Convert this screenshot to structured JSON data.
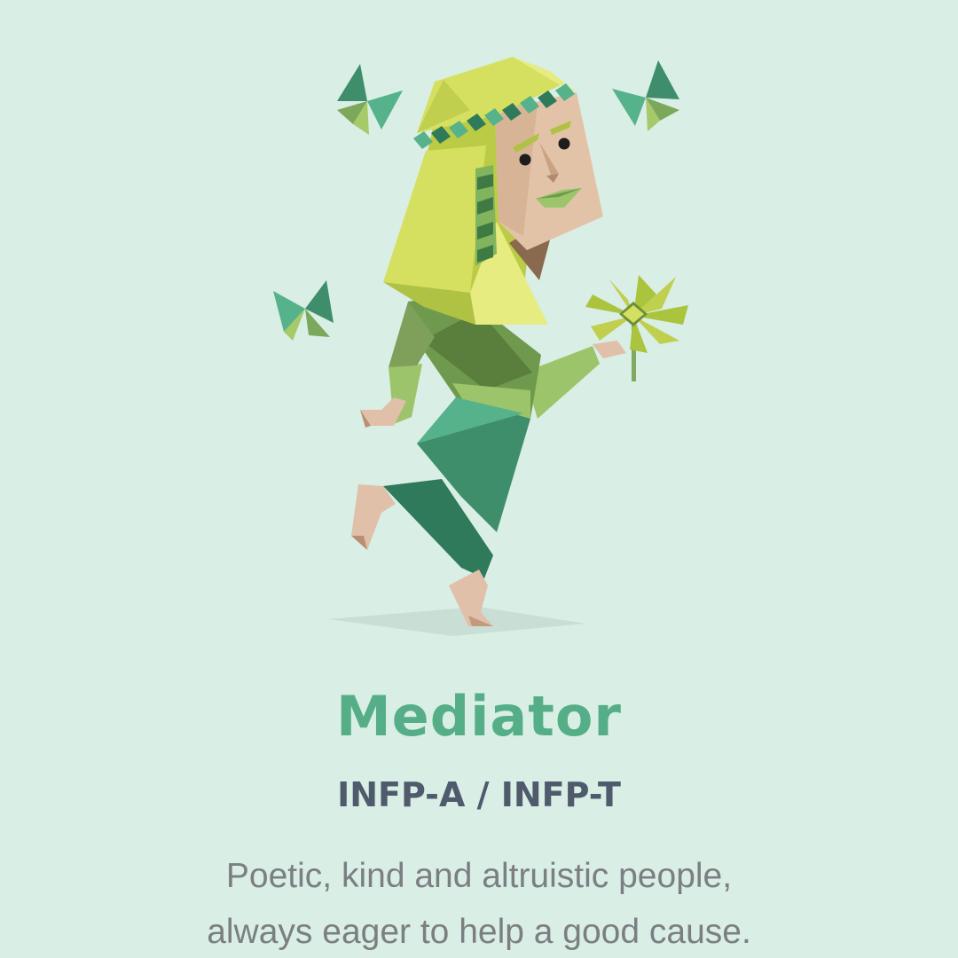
{
  "personality": {
    "name": "Mediator",
    "codes": "INFP-A / INFP-T",
    "description_lines": [
      "Poetic, kind and altruistic people,",
      "always eager to help a good cause."
    ]
  },
  "colors": {
    "background": "#d9eee5",
    "title": "#56ae88",
    "codes": "#4f5a6c",
    "description": "#7c7f82"
  },
  "illustration": {
    "icon": "mediator-character-icon"
  }
}
